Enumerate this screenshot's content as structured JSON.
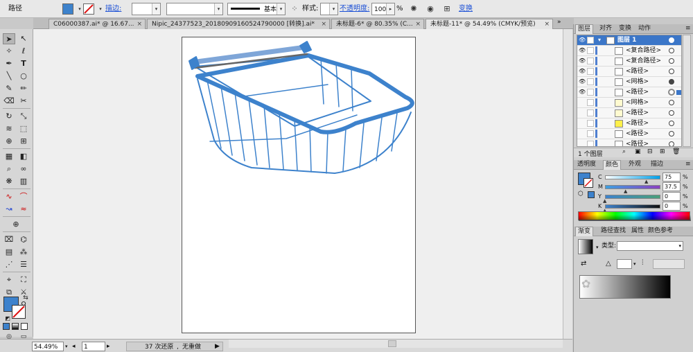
{
  "control_bar": {
    "object_type": "路径",
    "fill_color": "#3d82cc",
    "stroke_label": "描边:",
    "stroke_weight": "",
    "stroke_profile_label": "基本",
    "style_label": "样式:",
    "opacity_label": "不透明度:",
    "opacity_value": "100",
    "opacity_unit": "%",
    "transform_label": "变换"
  },
  "tabs": [
    {
      "label": "C06000387.ai* @ 16.67..."
    },
    {
      "label": "Nipic_24377523_20180909160524790000 [转换].ai*"
    },
    {
      "label": "未标题-6* @ 80.35% (C..."
    },
    {
      "label": "未标题-11* @ 54.49% (CMYK/预览)"
    }
  ],
  "status_bar": {
    "zoom": "54.49%",
    "page": "1",
    "undo_status": "37 次还原",
    "redo_status": "无重做"
  },
  "layers_panel": {
    "tabs": [
      "图层",
      "对齐",
      "变换",
      "动作"
    ],
    "rows": [
      {
        "name": "图层 1"
      },
      {
        "name": "<复合路径>"
      },
      {
        "name": "<复合路径>"
      },
      {
        "name": "<路径>"
      },
      {
        "name": "<网格>"
      },
      {
        "name": "<路径>"
      },
      {
        "name": "<网格>"
      },
      {
        "name": "<路径>"
      },
      {
        "name": "<路径>"
      },
      {
        "name": "<路径>"
      },
      {
        "name": "<路径>"
      }
    ],
    "footer": "1 个图层"
  },
  "color_panel": {
    "tabs": [
      "透明度",
      "颜色",
      "外观",
      "描边"
    ],
    "channels": [
      {
        "key": "C",
        "value": "75",
        "fraction": 0.75
      },
      {
        "key": "M",
        "value": "37.5",
        "fraction": 0.375
      },
      {
        "key": "Y",
        "value": "0",
        "fraction": 0
      },
      {
        "key": "K",
        "value": "0",
        "fraction": 0
      }
    ],
    "unit": "%"
  },
  "gradient_panel": {
    "tabs": [
      "渐变",
      "路径查找",
      "属性",
      "颜色参考"
    ],
    "type_label": "类型:",
    "type_value": ""
  },
  "colors": {
    "accent": "#3d82cc",
    "layer_highlight": "#3b76c8"
  }
}
